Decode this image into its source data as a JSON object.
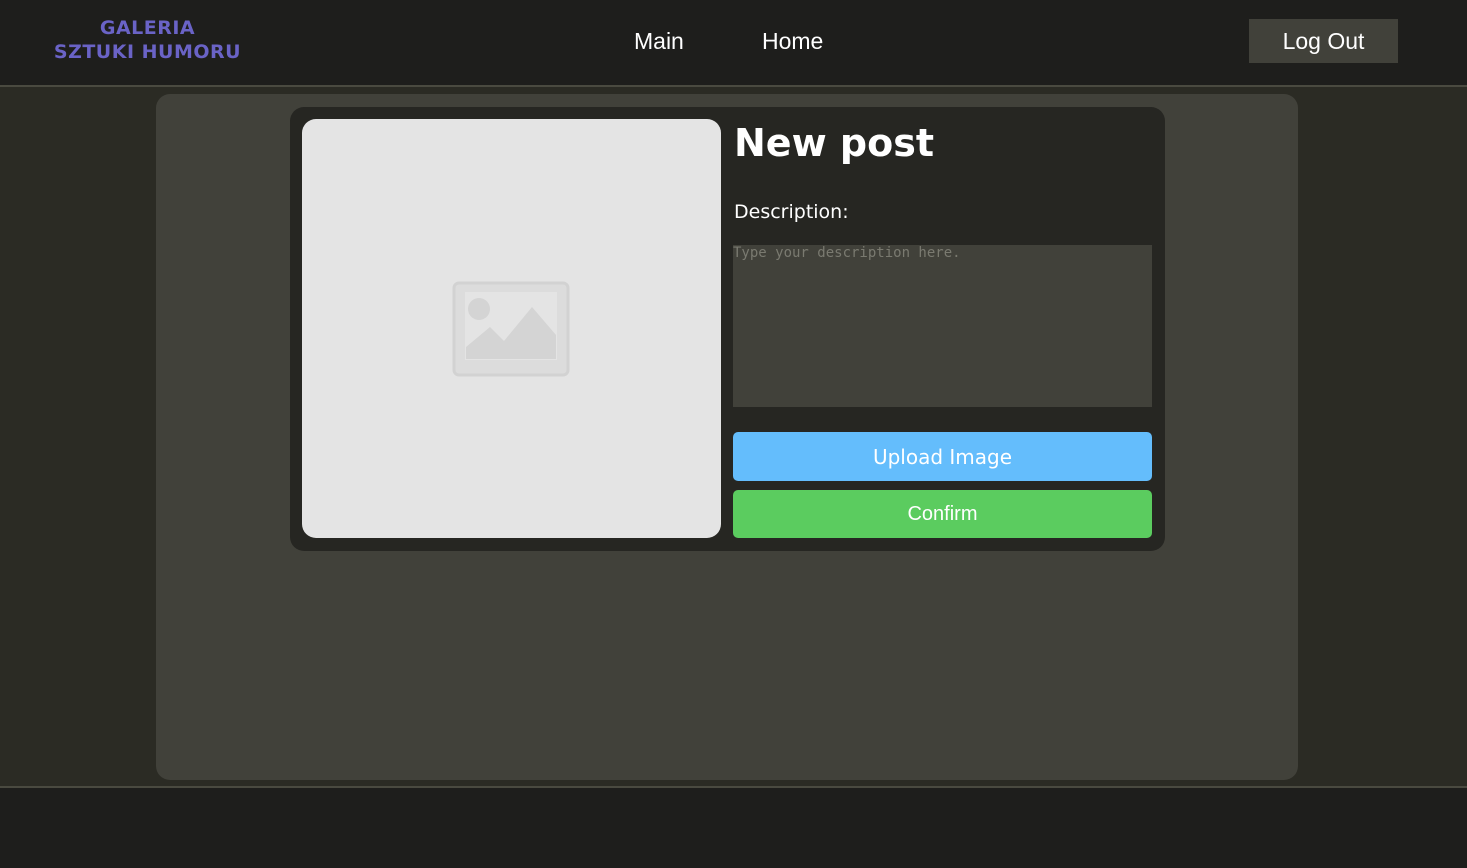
{
  "header": {
    "logo": {
      "line1": "GALERIA",
      "line2": "SZTUKI HUMORU",
      "color": "#6a63c6"
    },
    "nav": [
      {
        "label": "Main"
      },
      {
        "label": "Home"
      }
    ],
    "logout_label": "Log Out"
  },
  "new_post": {
    "title": "New post",
    "image_placeholder_icon": "image-placeholder-icon",
    "description_label": "Description:",
    "description_placeholder": "Type your description here.",
    "description_value": "",
    "upload_label": "Upload Image",
    "confirm_label": "Confirm"
  },
  "colors": {
    "upload_button": "#64bdfc",
    "confirm_button": "#5bcc5f",
    "panel": "#41413a",
    "card": "#262622"
  }
}
